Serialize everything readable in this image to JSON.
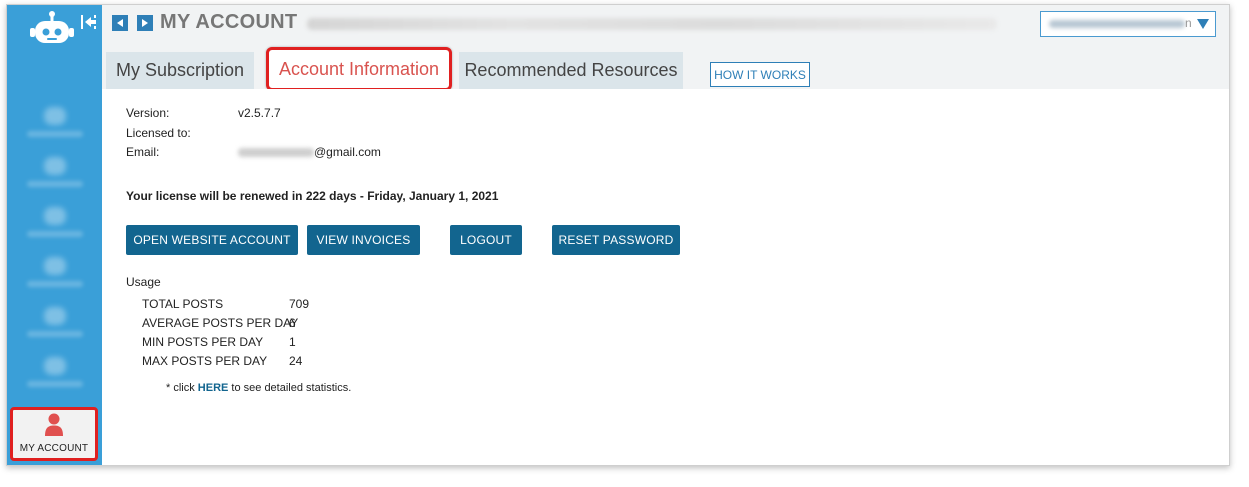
{
  "header": {
    "title": "MY ACCOUNT",
    "account_suffix": "n"
  },
  "sidebar": {
    "active_item": {
      "label": "MY ACCOUNT",
      "icon": "user-icon"
    }
  },
  "tabs": [
    {
      "label": "My Subscription",
      "active": false
    },
    {
      "label": "Account Information",
      "active": true
    },
    {
      "label": "Recommended Resources",
      "active": false
    }
  ],
  "how_it_works": "HOW IT WORKS",
  "account": {
    "version_label": "Version:",
    "version": "v2.5.7.7",
    "licensed_label": "Licensed to:",
    "email_label": "Email:",
    "email_domain": "@gmail.com",
    "renewal_text": "Your license will be renewed in 222 days -  Friday, January 1, 2021"
  },
  "buttons": {
    "open_website": "OPEN WEBSITE ACCOUNT",
    "view_invoices": "VIEW INVOICES",
    "logout": "LOGOUT",
    "reset_password": "RESET PASSWORD"
  },
  "usage": {
    "heading": "Usage",
    "stats": [
      {
        "label": "TOTAL POSTS",
        "value": "709"
      },
      {
        "label": "AVERAGE POSTS PER DAY",
        "value": "6"
      },
      {
        "label": "MIN POSTS PER DAY",
        "value": "1"
      },
      {
        "label": "MAX POSTS PER DAY",
        "value": "24"
      }
    ],
    "note_prefix": "* click",
    "note_link": "HERE",
    "note_suffix": "to see detailed statistics."
  },
  "colors": {
    "sidebar": "#3a9fd8",
    "primary_button": "#12658f",
    "highlight": "#e02020",
    "active_tab_text": "#d9534f"
  }
}
